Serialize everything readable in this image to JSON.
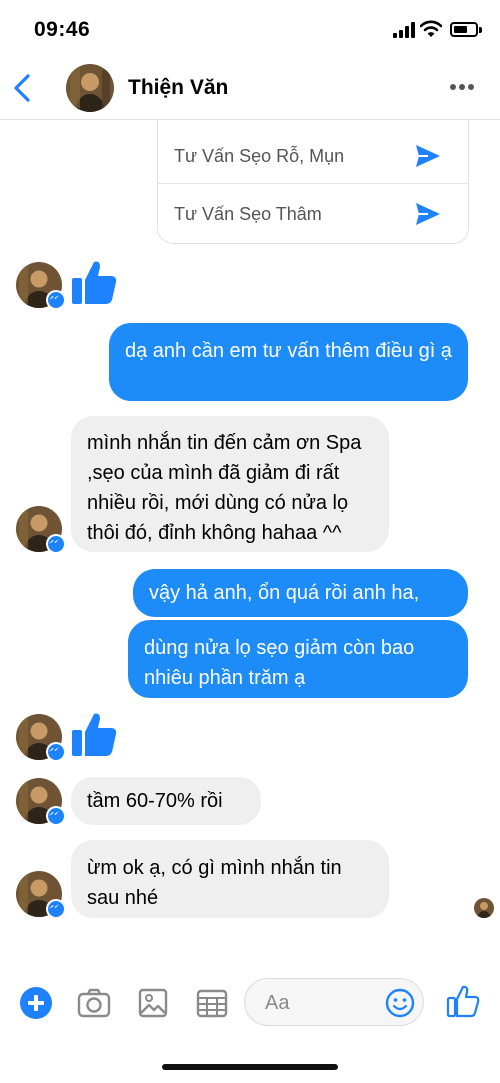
{
  "status_bar": {
    "time": "09:46"
  },
  "header": {
    "contact_name": "Thiện Văn"
  },
  "quick_replies": [
    {
      "label": "Tư Vấn Sẹo Rỗ, Mụn"
    },
    {
      "label": "Tư Vấn Sẹo Thâm"
    }
  ],
  "messages": [
    {
      "from": "them",
      "type": "like"
    },
    {
      "from": "me",
      "text": "dạ anh cần em tư vấn thêm điều gì ạ"
    },
    {
      "from": "them",
      "text": "mình nhắn tin đến cảm ơn Spa ,sẹo của mình đã giảm đi rất nhiều rồi, mới dùng có nửa lọ thôi đó, đỉnh không hahaa ^^"
    },
    {
      "from": "me",
      "text": "vậy hả anh, ổn quá rồi anh ha,"
    },
    {
      "from": "me",
      "text": "dùng nửa lọ sẹo giảm còn bao nhiêu phần trăm ạ"
    },
    {
      "from": "them",
      "type": "like"
    },
    {
      "from": "them",
      "text": "tầm 60-70% rồi"
    },
    {
      "from": "them",
      "text": "ừm ok ạ, có gì mình nhắn tin sau nhé"
    }
  ],
  "composer": {
    "placeholder": "Aa"
  },
  "colors": {
    "accent": "#1e82ff",
    "outgoing_bubble": "#1d8bf8",
    "incoming_bubble": "#efefef"
  },
  "icons": [
    "back-chevron-icon",
    "more-icon",
    "send-icon",
    "thumbs-up-icon",
    "plus-icon",
    "camera-icon",
    "image-icon",
    "sticker-grid-icon",
    "emoji-icon",
    "like-icon"
  ]
}
